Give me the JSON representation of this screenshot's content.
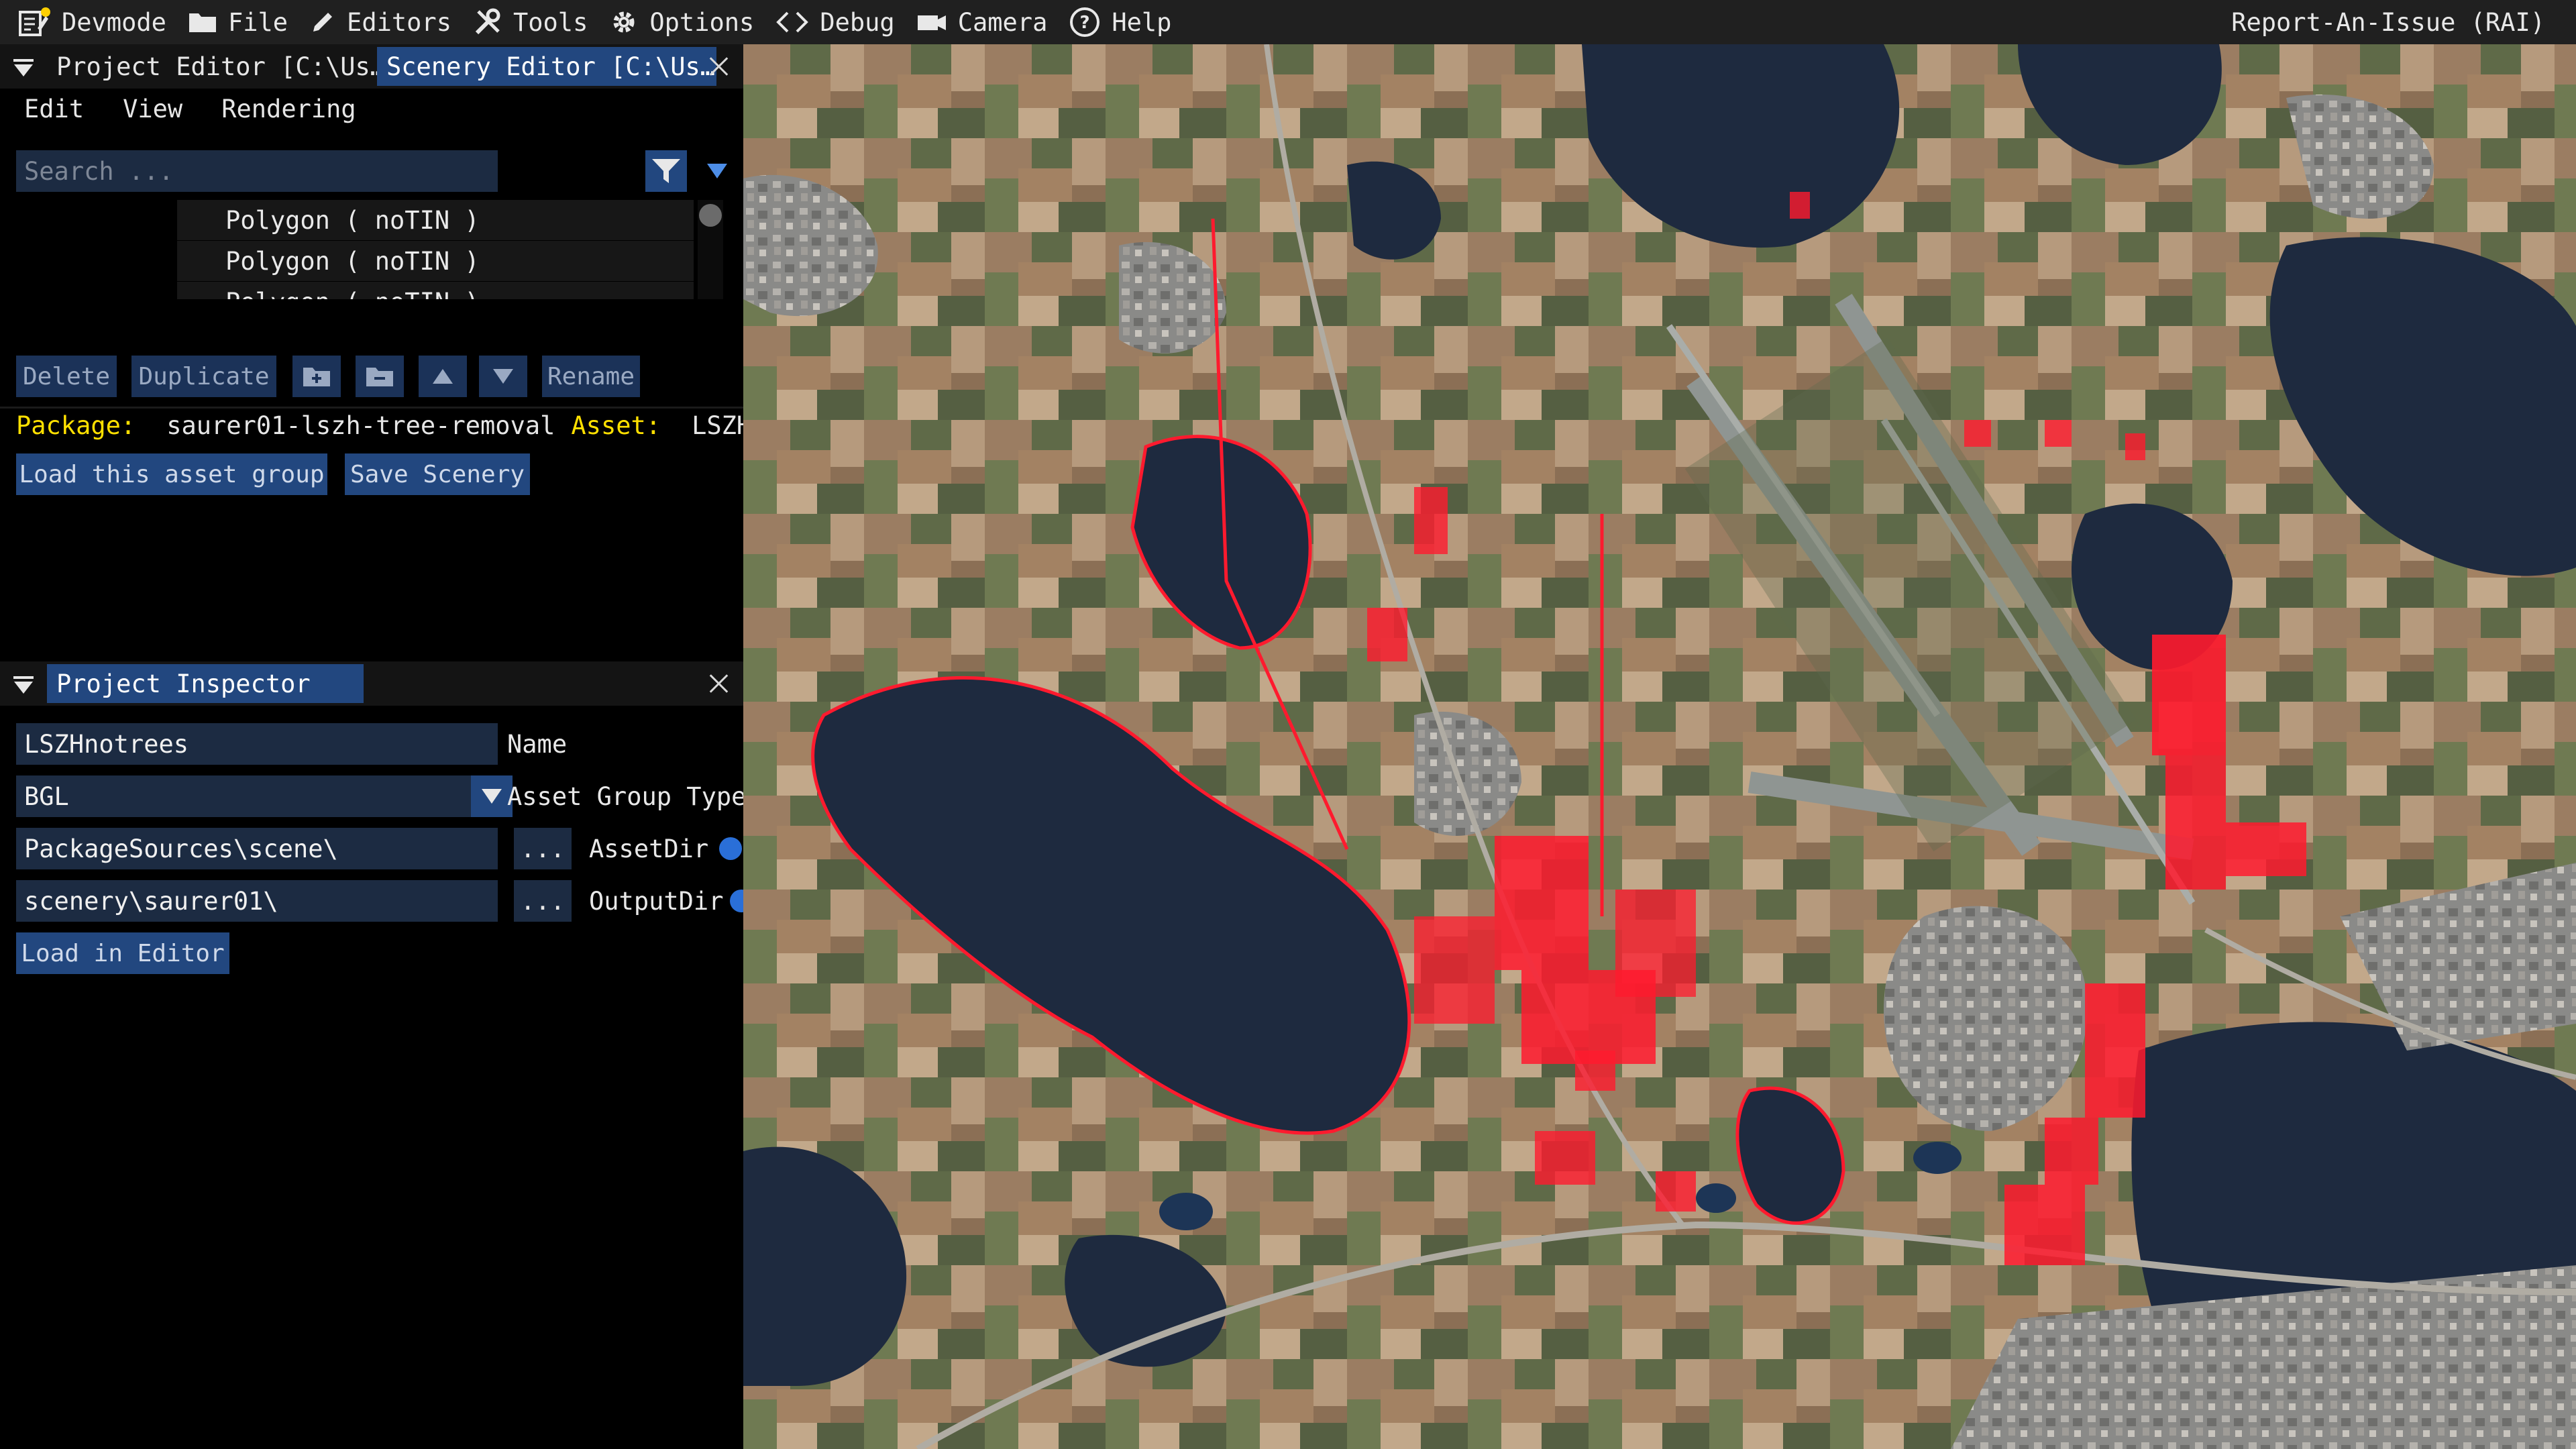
{
  "topbar": {
    "items": [
      {
        "label": "Devmode",
        "icon": "devmode-notes-icon"
      },
      {
        "label": "File",
        "icon": "folder-icon"
      },
      {
        "label": "Editors",
        "icon": "pencil-icon"
      },
      {
        "label": "Tools",
        "icon": "tools-icon"
      },
      {
        "label": "Options",
        "icon": "gear-icon"
      },
      {
        "label": "Debug",
        "icon": "code-brackets-icon"
      },
      {
        "label": "Camera",
        "icon": "camera-icon"
      },
      {
        "label": "Help",
        "icon": "help-circle-icon"
      }
    ],
    "report_issue": "Report-An-Issue (RAI)"
  },
  "editor_panel": {
    "tabs": [
      {
        "label": "Project Editor [C:\\Us…",
        "active": false
      },
      {
        "label": "Scenery Editor [C:\\Us…",
        "active": true
      }
    ],
    "menu": [
      "Edit",
      "View",
      "Rendering"
    ],
    "search_placeholder": "Search ...",
    "list_items": [
      "Polygon  ( noTIN )",
      "Polygon  ( noTIN )",
      "Polygon  ( noTIN )"
    ],
    "buttons": {
      "delete": "Delete",
      "duplicate": "Duplicate",
      "rename": "Rename",
      "load_asset_group": "Load this asset group",
      "save_scenery": "Save Scenery"
    },
    "package_label": "Package:",
    "package_value": "saurer01-lszh-tree-removal",
    "asset_label": "Asset:",
    "asset_value": "LSZHnc"
  },
  "inspector_panel": {
    "tab": "Project Inspector",
    "fields": {
      "name_value": "LSZHnotrees",
      "name_label": "Name",
      "type_value": "BGL",
      "type_label": "Asset Group Type",
      "assetdir_value": "PackageSources\\scene\\",
      "assetdir_label": "AssetDir",
      "outputdir_value": "scenery\\saurer01\\",
      "outputdir_label": "OutputDir",
      "browse": "..."
    },
    "load_editor": "Load in Editor"
  },
  "colors": {
    "accent": "#22477f",
    "field_bg": "#1c2b42",
    "package_label": "#ffe000",
    "polygon_overlay": "#ff1a2e"
  }
}
